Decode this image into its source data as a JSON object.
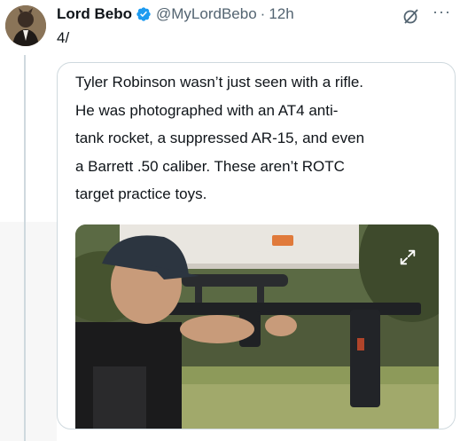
{
  "author": {
    "name": "Lord Bebo",
    "handle": "@MyLordBebo",
    "separator": "·",
    "time": "12h",
    "verified_color": "#1d9bf0"
  },
  "post": {
    "text": "4/"
  },
  "quote": {
    "lines": [
      "Tyler Robinson wasn’t just seen with a rifle.",
      "He was photographed with an AT4 anti-",
      "tank rocket, a suppressed AR-15, and even",
      "a Barrett .50 caliber. These aren’t ROTC",
      "target practice toys."
    ]
  },
  "icons": {
    "verified": "verified-badge-icon",
    "grok": "grok-icon",
    "more": "more-icon",
    "expand": "expand-icon"
  },
  "colors": {
    "text_primary": "#0f1419",
    "text_secondary": "#536471",
    "border": "#cfd9de"
  }
}
